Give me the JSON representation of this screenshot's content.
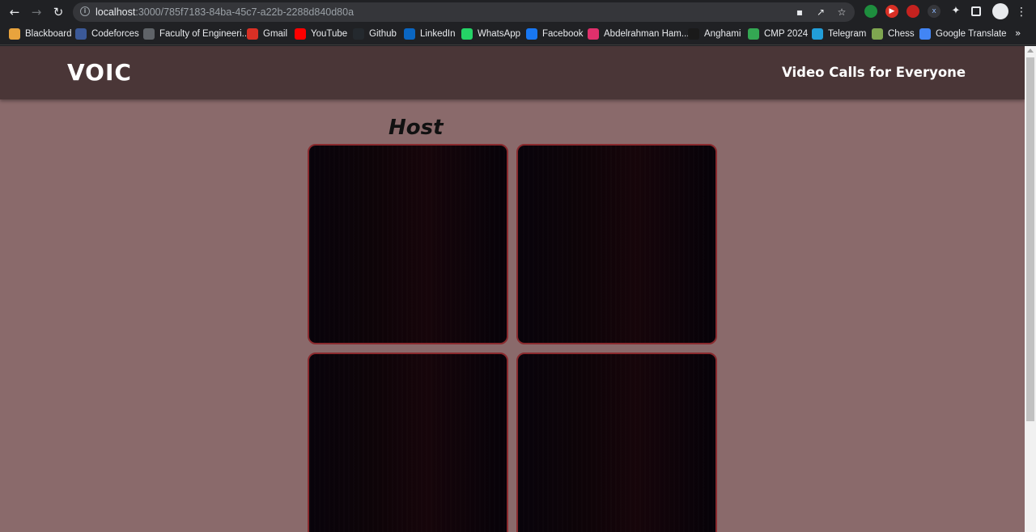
{
  "browser": {
    "url_host": "localhost",
    "url_path": ":3000/785f7183-84ba-45c7-a22b-2288d840d80a",
    "bookmarks": [
      {
        "label": "Blackboard",
        "icon": "blackboard-icon",
        "color": "#e8a33d"
      },
      {
        "label": "Codeforces",
        "icon": "codeforces-icon",
        "color": "#3b5998"
      },
      {
        "label": "Faculty of Engineeri...",
        "icon": "globe-icon",
        "color": "#5f6368"
      },
      {
        "label": "Gmail",
        "icon": "gmail-icon",
        "color": "#d93025"
      },
      {
        "label": "YouTube",
        "icon": "youtube-icon",
        "color": "#ff0000"
      },
      {
        "label": "Github",
        "icon": "github-icon",
        "color": "#24292e"
      },
      {
        "label": "LinkedIn",
        "icon": "linkedin-icon",
        "color": "#0a66c2"
      },
      {
        "label": "WhatsApp",
        "icon": "whatsapp-icon",
        "color": "#25d366"
      },
      {
        "label": "Facebook",
        "icon": "facebook-icon",
        "color": "#1877f2"
      },
      {
        "label": "Abdelrahman Ham...",
        "icon": "instagram-icon",
        "color": "#e1306c"
      },
      {
        "label": "Anghami",
        "icon": "anghami-icon",
        "color": "#1a1a1a"
      },
      {
        "label": "CMP 2024",
        "icon": "google-drive-icon",
        "color": "#34a853"
      },
      {
        "label": "Telegram",
        "icon": "telegram-icon",
        "color": "#229ed9"
      },
      {
        "label": "Chess",
        "icon": "chess-icon",
        "color": "#7fa650"
      },
      {
        "label": "Google Translate",
        "icon": "google-translate-icon",
        "color": "#4285f4"
      }
    ]
  },
  "app": {
    "logo": "VOIC",
    "tagline": "Video Calls for Everyone",
    "section_title": "Host",
    "colors": {
      "header_bg": "#4a3637",
      "page_bg": "#8a6a6b",
      "tile_border": "#8a2a2e"
    },
    "video_tiles": [
      {
        "id": "video-tile-1"
      },
      {
        "id": "video-tile-2"
      },
      {
        "id": "video-tile-3"
      },
      {
        "id": "video-tile-4"
      }
    ]
  }
}
